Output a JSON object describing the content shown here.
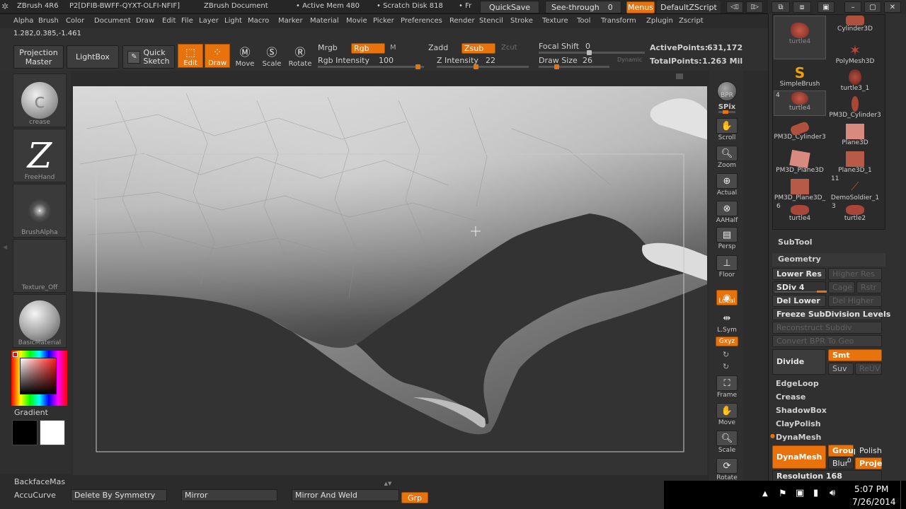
{
  "titlebar": {
    "app": "ZBrush 4R6",
    "product_id": "P2[DFIB-BWFF-QYXT-OLFI-NFIF]",
    "document": "ZBrush Document",
    "active_mem": "• Active Mem 480",
    "scratch_disk": "• Scratch Disk 818",
    "fr": "• Fr",
    "quicksave": "QuickSave",
    "see_through": "See-through",
    "see_through_value": "0",
    "menus": "Menus",
    "zscript": "DefaultZScript"
  },
  "menubar": {
    "items": [
      "Alpha",
      "Brush",
      "Color",
      "Document",
      "Draw",
      "Edit",
      "File",
      "Layer",
      "Light",
      "Macro",
      "Marker",
      "Material",
      "Movie",
      "Picker",
      "Preferences",
      "Render",
      "Stencil",
      "Stroke",
      "Texture",
      "Tool",
      "Transform",
      "Zplugin",
      "Zscript"
    ]
  },
  "coords": "1.282,0.385,-1.461",
  "toolbar": {
    "projection_master": [
      "Projection",
      "Master"
    ],
    "lightbox": "LightBox",
    "quick_sketch": [
      "Quick",
      "Sketch"
    ],
    "edit": "Edit",
    "draw": "Draw",
    "move": "Move",
    "scale": "Scale",
    "rotate": "Rotate",
    "mrgb": "Mrgb",
    "rgb": "Rgb",
    "m": "M",
    "zadd": "Zadd",
    "zsub": "Zsub",
    "zcut": "Zcut",
    "rgb_intensity_label": "Rgb Intensity",
    "rgb_intensity_value": "100",
    "z_intensity_label": "Z Intensity",
    "z_intensity_value": "22",
    "focal_shift_label": "Focal Shift",
    "focal_shift_value": "0",
    "draw_size_label": "Draw Size",
    "draw_size_value": "26",
    "dynamic": "Dynamic",
    "active_points_label": "ActivePoints:",
    "active_points_value": "631,172",
    "total_points_label": "TotalPoints:",
    "total_points_value": "1.263 Mil"
  },
  "leftshelf": {
    "brush": "crease",
    "stroke": "FreeHand",
    "alpha": "BrushAlpha",
    "texture": "Texture_Off",
    "material": "BasicMaterial",
    "gradient": "Gradient"
  },
  "rightshelf": {
    "items": [
      "BPR",
      "SPix",
      "Scroll",
      "Zoom",
      "Actual",
      "AAHalf",
      "Persp",
      "Floor",
      "Local",
      "L.Sym",
      "Gxyz",
      "Frame",
      "Move",
      "Scale",
      "Rotate"
    ]
  },
  "palette": {
    "tools": [
      {
        "name": "turtle4",
        "count": ""
      },
      {
        "name": "Cylinder3D",
        "count": ""
      },
      {
        "name": "SimpleBrush",
        "count": ""
      },
      {
        "name": "PolyMesh3D",
        "count": ""
      },
      {
        "name": "turtle4",
        "count": "4"
      },
      {
        "name": "turtle3_1",
        "count": ""
      },
      {
        "name": "PM3D_Cylinder3",
        "count": ""
      },
      {
        "name": "PM3D_Cylinder3",
        "count": ""
      },
      {
        "name": "Plane3D",
        "count": ""
      },
      {
        "name": "PM3D_Plane3D",
        "count": ""
      },
      {
        "name": "Plane3D_1",
        "count": ""
      },
      {
        "name": "PM3D_Plane3D_",
        "count": "6"
      },
      {
        "name": "DemoSoldier_1",
        "count": "11"
      },
      {
        "name": "turtle4",
        "count": ""
      },
      {
        "name": "turtle2",
        "count": "3"
      }
    ],
    "subtool": "SubTool",
    "geometry": "Geometry",
    "lower_res": "Lower Res",
    "higher_res": "Higher Res",
    "sdiv": "SDiv 4",
    "cage": "Cage",
    "rstr": "Rstr",
    "del_lower": "Del Lower",
    "del_higher": "Del Higher",
    "freeze": "Freeze SubDivision Levels",
    "reconstruct": "Reconstruct Subdiv",
    "convert_bpr": "Convert BPR To Geo",
    "divide": "Divide",
    "smt": "Smt",
    "suv": "Suv",
    "reuv": "ReUV",
    "edgeloop": "EdgeLoop",
    "crease": "Crease",
    "shadowbox": "ShadowBox",
    "claypolish": "ClayPolish",
    "dynamesh_header": "DynaMesh",
    "dynamesh": "DynaMesh",
    "group": "Group",
    "polish": "Polish",
    "blur": "Blur",
    "blur_value": "0",
    "proje": "Proje",
    "resolution": "Resolution 168"
  },
  "bottombar": {
    "backface": "BackfaceMas",
    "accucurve": "AccuCurve",
    "delete_by_symmetry": "Delete By Symmetry",
    "mirror": "Mirror",
    "mirror_and_weld": "Mirror And Weld",
    "grp": "Grp"
  },
  "taskbar": {
    "time": "5:07 PM",
    "date": "7/26/2014"
  },
  "colors": {
    "accent": "#e8720c",
    "background": "#2c2c2c"
  }
}
